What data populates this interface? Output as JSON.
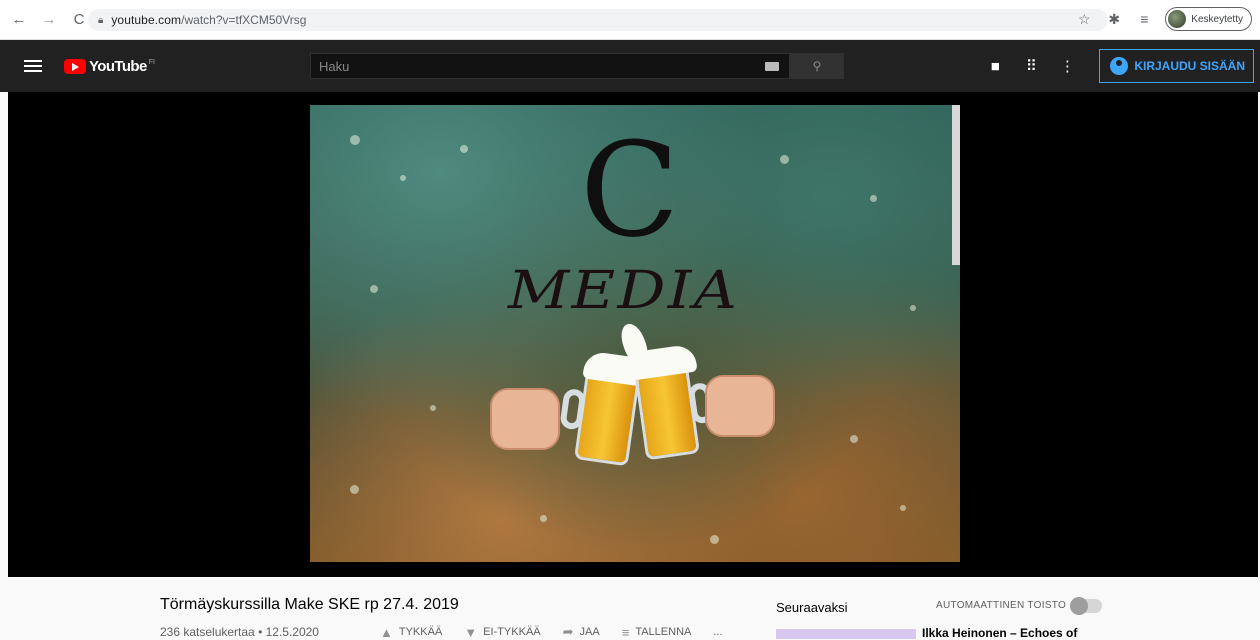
{
  "browser": {
    "url_host": "youtube.com",
    "url_path": "/watch?v=tfXCM50Vrsg",
    "profile_label": "Keskeytetty",
    "icons": [
      "back-arrow-icon",
      "forward-arrow-icon",
      "reload-icon",
      "lock-icon",
      "star-icon",
      "extensions-icon",
      "reading-list-icon"
    ]
  },
  "masthead": {
    "logo_text": "YouTube",
    "logo_country": "FI",
    "search_placeholder": "Haku",
    "signin_label": "KIRJAUDU SISÄÄN",
    "icons": [
      "menu-icon",
      "create-video-icon",
      "apps-grid-icon",
      "more-vert-icon",
      "search-icon",
      "keyboard-icon"
    ]
  },
  "video": {
    "logo_letter": "C",
    "logo_word": "MEDIA",
    "title": "Törmäyskurssilla Make SKE rp 27.4. 2019",
    "meta": "236 katselukertaa • 12.5.2020",
    "actions": {
      "like": "TYKKÄÄ",
      "dislike": "EI-TYKKÄÄ",
      "share": "JAA",
      "save": "TALLENNA",
      "more": "..."
    }
  },
  "sidebar": {
    "up_next_label": "Seuraavaksi",
    "autoplay_label": "AUTOMAATTINEN TOISTO",
    "autoplay_on": false,
    "next_video_title": "Ilkka Heinonen – Echoes of"
  },
  "colors": {
    "masthead_bg": "#212121",
    "brand_red": "#ff0000",
    "signin_blue": "#3ea6ff"
  }
}
